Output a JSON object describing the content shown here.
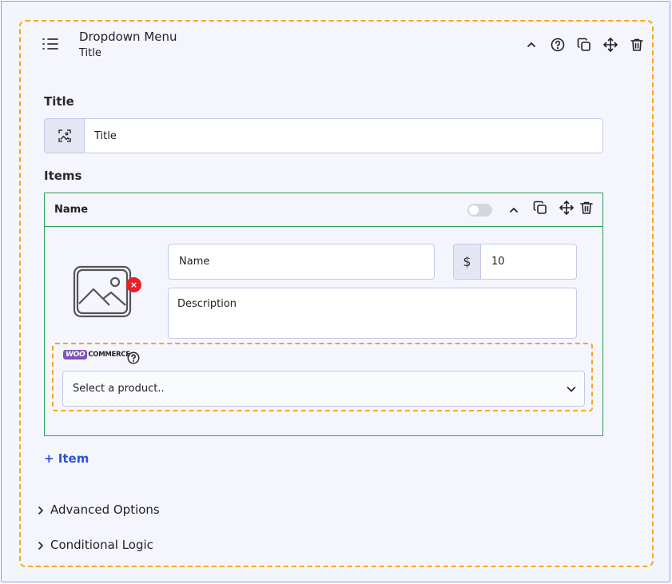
{
  "widget": {
    "title": "Dropdown Menu",
    "subtitle": "Title",
    "icons": [
      "list-icon",
      "chevron-up-icon",
      "help-icon",
      "duplicate-icon",
      "move-icon",
      "trash-icon"
    ]
  },
  "title_section": {
    "label": "Title",
    "input_placeholder": "Title",
    "addon_icon": "image-frame-icon"
  },
  "items_section": {
    "label": "Items",
    "item": {
      "header_name": "Name",
      "toggle_on": false,
      "name_placeholder": "Name",
      "currency_symbol": "$",
      "price_value": "10",
      "description_placeholder": "Description",
      "remove_image_symbol": "×",
      "woocommerce": {
        "logo_badge": "WOO",
        "logo_text": "COMMERCE",
        "select_value": "Select a product.."
      }
    },
    "add_item_label": "+ Item"
  },
  "advanced_options_label": "Advanced Options",
  "conditional_logic_label": "Conditional Logic",
  "colors": {
    "accent_dashed": "#f5a623",
    "item_border": "#2e9e55",
    "link_blue": "#2f52d8",
    "remove_red": "#e8202a",
    "woo_purple": "#7f54b3"
  }
}
